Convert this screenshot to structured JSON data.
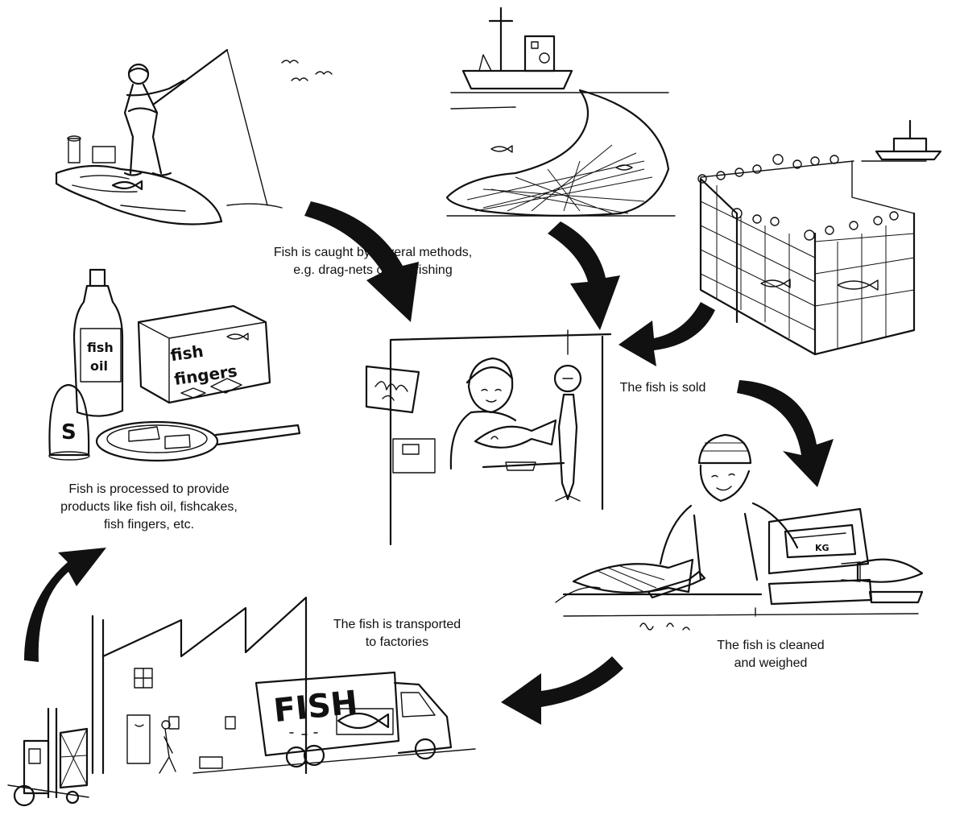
{
  "diagram": {
    "steps": [
      {
        "id": "caught",
        "lines": [
          "Fish is caught by several methods,",
          "e.g. drag-nets or line fishing"
        ]
      },
      {
        "id": "sold",
        "lines": [
          "The fish is sold"
        ]
      },
      {
        "id": "cleaned",
        "lines": [
          "The fish is cleaned",
          "and weighed"
        ]
      },
      {
        "id": "transported",
        "lines": [
          "The fish is transported",
          "to factories"
        ]
      },
      {
        "id": "processed",
        "lines": [
          "Fish is processed to provide",
          "products like fish oil, fishcakes,",
          "fish fingers, etc."
        ]
      }
    ],
    "illustrations": {
      "oil_bottle_label_line1": "fish",
      "oil_bottle_label_line2": "oil",
      "box_label_line1": "fish",
      "box_label_line2": "fingers",
      "shaker_label": "S",
      "truck_label": "FISH",
      "scale_label": "KG"
    }
  }
}
